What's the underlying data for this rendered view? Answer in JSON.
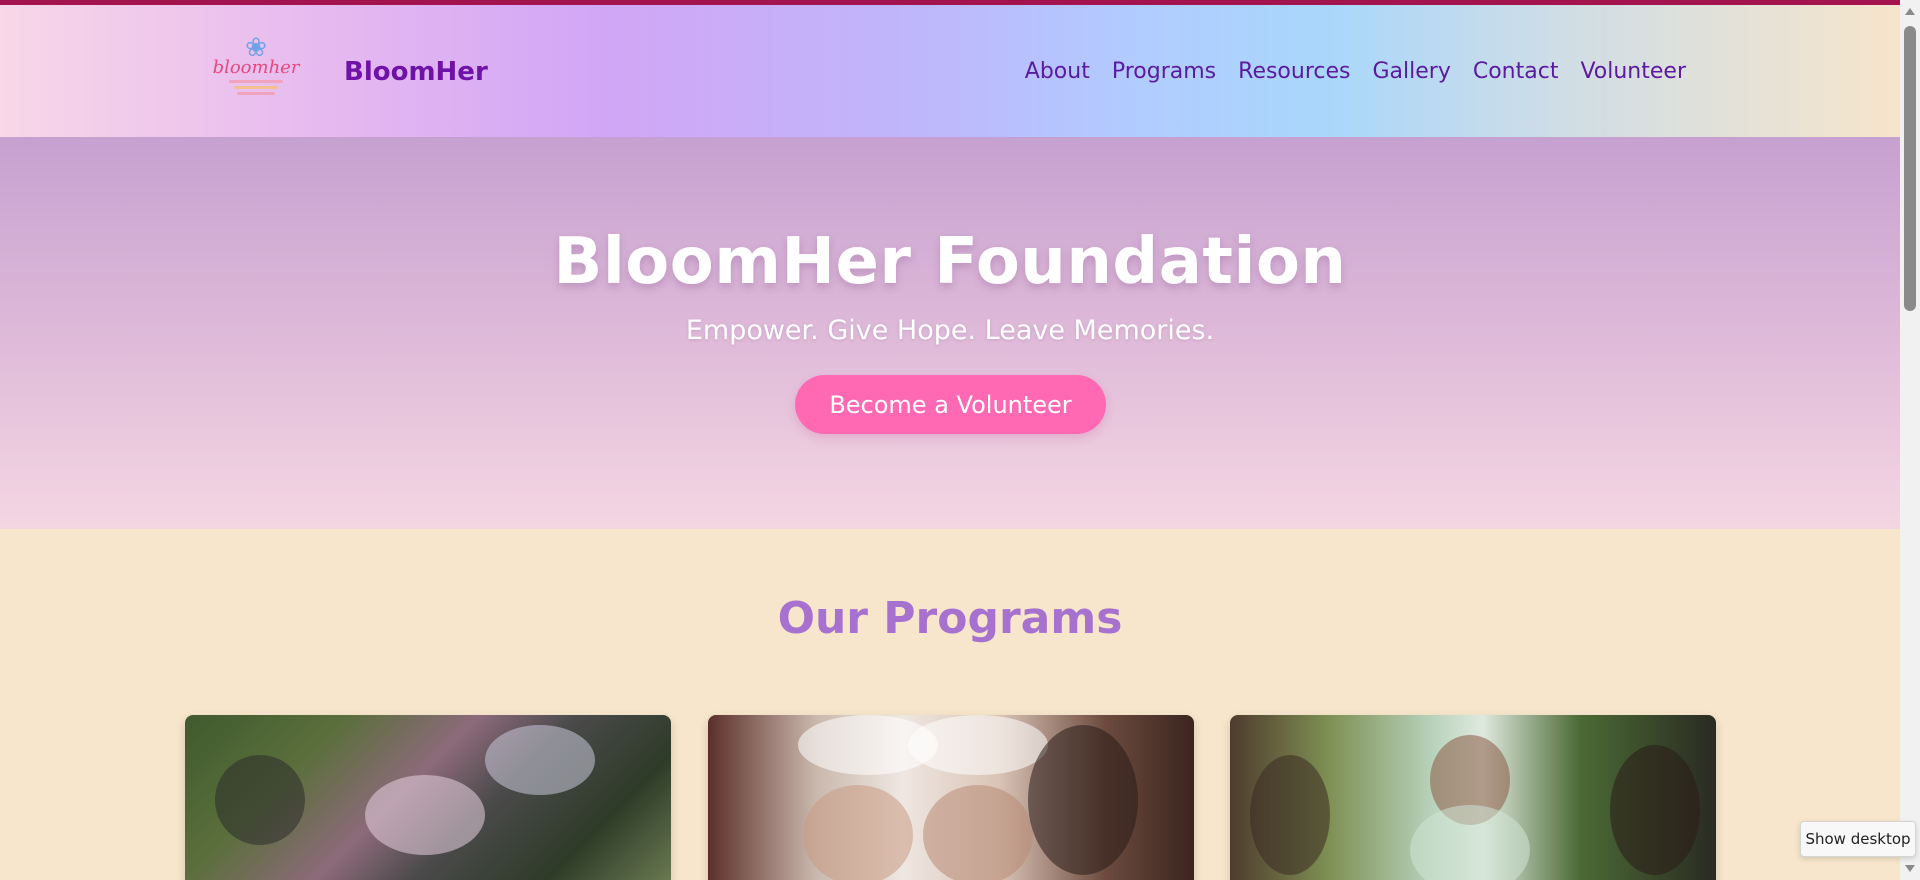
{
  "header": {
    "logo_text": "bloomher",
    "brand": "BloomHer",
    "nav": [
      "About",
      "Programs",
      "Resources",
      "Gallery",
      "Contact",
      "Volunteer"
    ]
  },
  "hero": {
    "title": "BloomHer Foundation",
    "tagline": "Empower. Give Hope. Leave Memories.",
    "cta": "Become a Volunteer"
  },
  "programs": {
    "heading": "Our Programs"
  },
  "os": {
    "tooltip": "Show desktop"
  },
  "colors": {
    "brand_purple": "#6f12a8",
    "nav_purple": "#5b1aa0",
    "heading_purple": "#a771cf",
    "cta_pink": "#ff69b4",
    "page_background": "#f7e6cb",
    "top_accent": "#a3144e"
  }
}
